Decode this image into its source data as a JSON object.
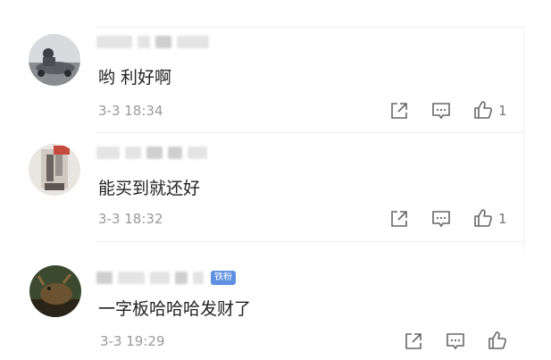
{
  "comments": [
    {
      "text": "哟 利好啊",
      "date": "3-3 18:34",
      "likes": "1",
      "badge": ""
    },
    {
      "text": "能买到就还好",
      "date": "3-3 18:32",
      "likes": "1",
      "badge": ""
    },
    {
      "text": "一字板哈哈哈发财了",
      "date": "3-3 19:29",
      "likes": "",
      "badge": "铁粉"
    }
  ],
  "icons": {
    "share": "share-icon",
    "reply": "comment-icon",
    "like": "thumbs-up-icon"
  },
  "colors": {
    "text": "#222222",
    "meta": "#999999",
    "badge": "#5f8fe0",
    "icon": "#666666"
  }
}
